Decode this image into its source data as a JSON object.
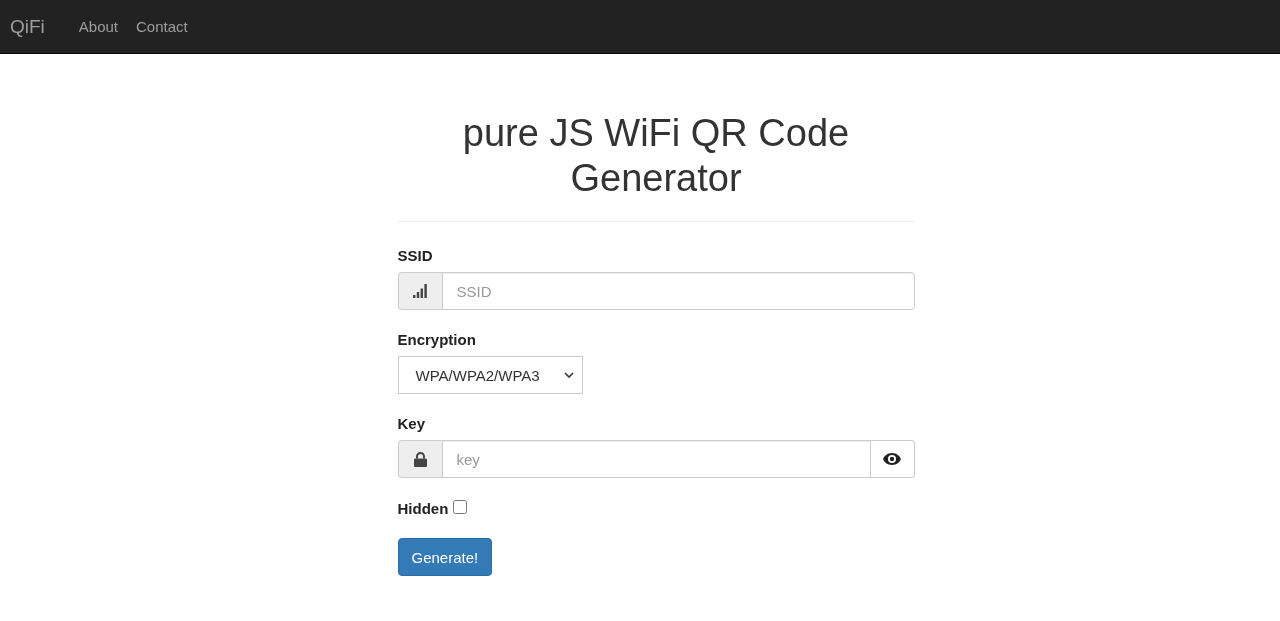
{
  "navbar": {
    "brand": "QiFi",
    "links": [
      {
        "label": "About"
      },
      {
        "label": "Contact"
      }
    ]
  },
  "title": "pure JS WiFi QR Code Generator",
  "form": {
    "ssid": {
      "label": "SSID",
      "placeholder": "SSID"
    },
    "encryption": {
      "label": "Encryption",
      "value": "WPA/WPA2/WPA3"
    },
    "key": {
      "label": "Key",
      "placeholder": "key"
    },
    "hidden": {
      "label": "Hidden",
      "checked": false
    },
    "submit": "Generate!"
  }
}
